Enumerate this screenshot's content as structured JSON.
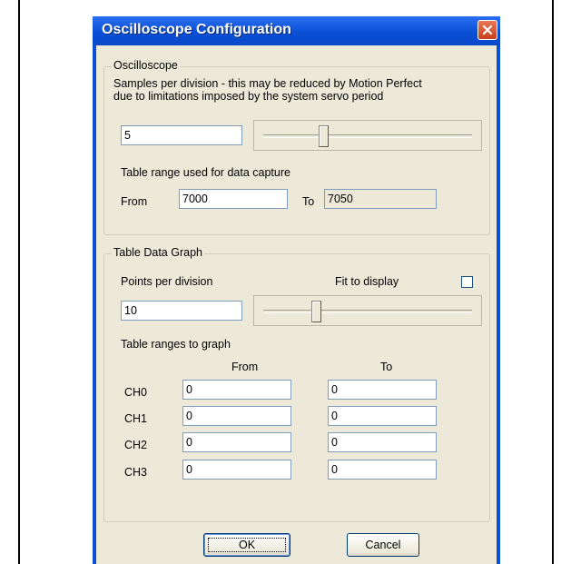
{
  "window": {
    "title": "Oscilloscope Configuration"
  },
  "oscilloscope": {
    "legend": "Oscilloscope",
    "desc_line1": "Samples per division - this may be reduced by Motion Perfect",
    "desc_line2": "due to limitations imposed by the system servo period",
    "samples_value": "5",
    "samples_slider_level": 0.28,
    "table_range_label": "Table range used for data capture",
    "from_label": "From",
    "from_value": "7000",
    "to_label": "To",
    "to_value": "7050"
  },
  "table_graph": {
    "legend": "Table Data Graph",
    "points_label": "Points per division",
    "fit_label": "Fit to display",
    "fit_checked": false,
    "points_value": "10",
    "points_slider_level": 0.24,
    "ranges_label": "Table ranges to graph",
    "col_from": "From",
    "col_to": "To",
    "channels": [
      {
        "name": "CH0",
        "from": "0",
        "to": "0"
      },
      {
        "name": "CH1",
        "from": "0",
        "to": "0"
      },
      {
        "name": "CH2",
        "from": "0",
        "to": "0"
      },
      {
        "name": "CH3",
        "from": "0",
        "to": "0"
      }
    ]
  },
  "buttons": {
    "ok": "OK",
    "cancel": "Cancel"
  }
}
